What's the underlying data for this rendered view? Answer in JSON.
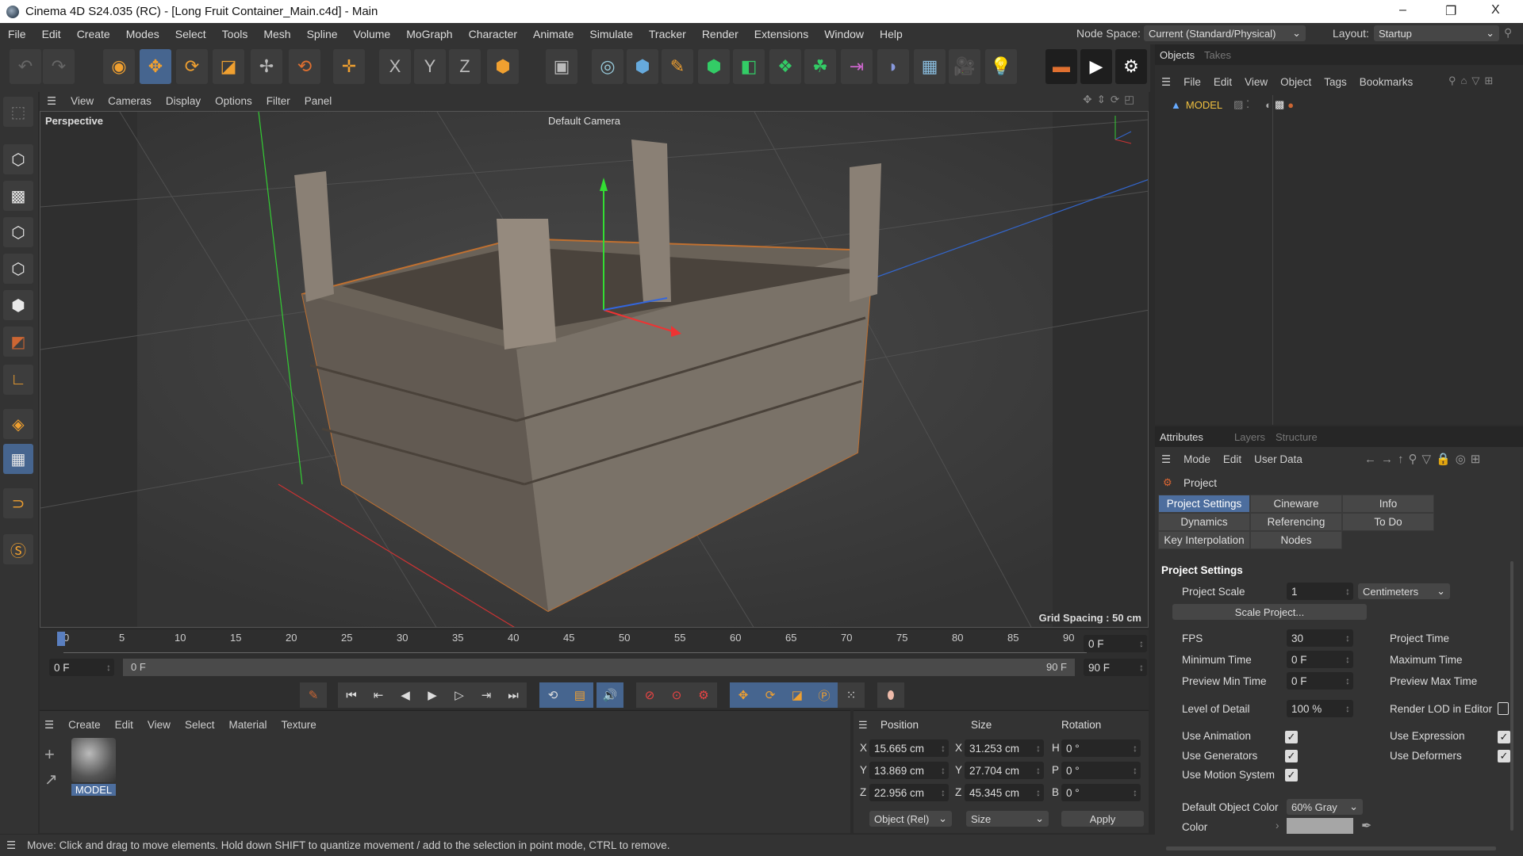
{
  "window": {
    "title": "Cinema 4D S24.035 (RC) - [Long Fruit Container_Main.c4d] - Main",
    "minimize": "–",
    "maximize": "❐",
    "close": "X"
  },
  "menu": [
    "File",
    "Edit",
    "Create",
    "Modes",
    "Select",
    "Tools",
    "Mesh",
    "Spline",
    "Volume",
    "MoGraph",
    "Character",
    "Animate",
    "Simulate",
    "Tracker",
    "Render",
    "Extensions",
    "Window",
    "Help"
  ],
  "node_space": {
    "label": "Node Space:",
    "value": "Current (Standard/Physical)"
  },
  "layout": {
    "label": "Layout:",
    "value": "Startup"
  },
  "viewport": {
    "menu": [
      "View",
      "Cameras",
      "Display",
      "Options",
      "Filter",
      "Panel"
    ],
    "name": "Perspective",
    "camera": "Default Camera",
    "grid_spacing": "Grid Spacing : 50 cm"
  },
  "timeline": {
    "ticks": [
      "0",
      "5",
      "10",
      "15",
      "20",
      "25",
      "30",
      "35",
      "40",
      "45",
      "50",
      "55",
      "60",
      "65",
      "70",
      "75",
      "80",
      "85",
      "90"
    ],
    "current_frame": "0 F",
    "start": "0 F",
    "range_start": "0 F",
    "range_end": "90 F",
    "end": "90 F"
  },
  "material_manager": {
    "menu": [
      "Create",
      "Edit",
      "View",
      "Select",
      "Material",
      "Texture"
    ],
    "material": "MODEL"
  },
  "coordinates": {
    "headers": [
      "Position",
      "Size",
      "Rotation"
    ],
    "rows": [
      {
        "pl": "X",
        "pos": "15.665 cm",
        "sl": "X",
        "size": "31.253 cm",
        "rl": "H",
        "rot": "0 °"
      },
      {
        "pl": "Y",
        "pos": "13.869 cm",
        "sl": "Y",
        "size": "27.704 cm",
        "rl": "P",
        "rot": "0 °"
      },
      {
        "pl": "Z",
        "pos": "22.956 cm",
        "sl": "Z",
        "size": "45.345 cm",
        "rl": "B",
        "rot": "0 °"
      }
    ],
    "mode": "Object (Rel)",
    "size_mode": "Size",
    "apply": "Apply"
  },
  "status": "Move: Click and drag to move elements. Hold down SHIFT to quantize movement / add to the selection in point mode, CTRL to remove.",
  "objects": {
    "tabs": [
      "Objects",
      "Takes"
    ],
    "menu": [
      "File",
      "Edit",
      "View",
      "Object",
      "Tags",
      "Bookmarks"
    ],
    "item": "MODEL"
  },
  "attributes": {
    "tabs": [
      "Attributes",
      "Layers",
      "Structure"
    ],
    "menu": [
      "Mode",
      "Edit",
      "User Data"
    ],
    "object": "Project",
    "subtabs": [
      "Project Settings",
      "Cineware",
      "Info",
      "Dynamics",
      "Referencing",
      "To Do",
      "Key Interpolation",
      "Nodes"
    ],
    "section": "Project Settings",
    "project_scale": {
      "label": "Project Scale",
      "value": "1",
      "unit": "Centimeters"
    },
    "scale_button": "Scale Project...",
    "fps": {
      "label": "FPS",
      "value": "30"
    },
    "min_time": {
      "label": "Minimum Time",
      "value": "0 F"
    },
    "preview_min": {
      "label": "Preview Min Time",
      "value": "0 F"
    },
    "project_time": "Project Time",
    "max_time": "Maximum Time",
    "preview_max": "Preview Max Time",
    "lod": {
      "label": "Level of Detail",
      "value": "100 %"
    },
    "render_lod": "Render LOD in Editor",
    "use_animation": "Use Animation",
    "use_generators": "Use Generators",
    "use_motion": "Use Motion System",
    "use_expression": "Use Expression",
    "use_deformers": "Use Deformers",
    "default_color": {
      "label": "Default Object Color",
      "value": "60% Gray"
    },
    "color_label": "Color",
    "color_value": "#a6a6a6"
  }
}
